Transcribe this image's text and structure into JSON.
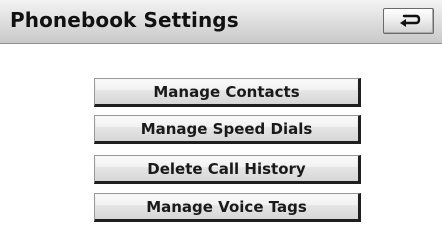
{
  "header": {
    "title": "Phonebook Settings",
    "back_icon": "back-arrow-icon"
  },
  "menu": {
    "items": [
      {
        "label": "Manage Contacts"
      },
      {
        "label": "Manage Speed Dials"
      },
      {
        "label": "Delete Call History"
      },
      {
        "label": "Manage Voice Tags"
      }
    ]
  },
  "colors": {
    "header_gradient_top": "#f4f4f4",
    "header_gradient_bottom": "#c9c9c9",
    "button_face": "#e6e6e6",
    "button_shadow": "#1f1f1f",
    "text": "#111111"
  }
}
